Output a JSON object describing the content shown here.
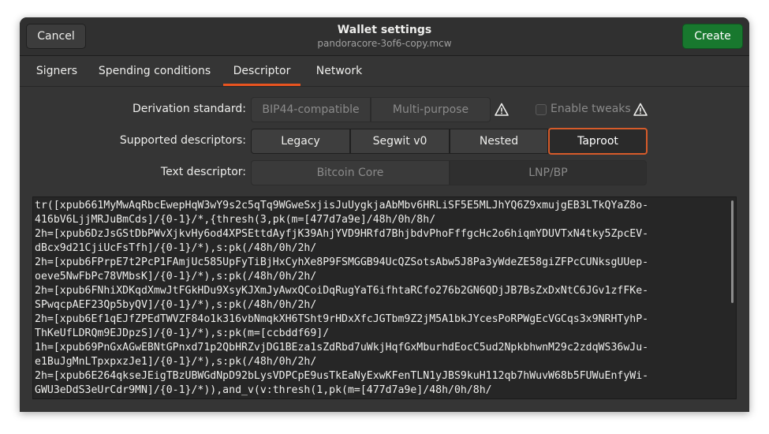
{
  "header": {
    "title": "Wallet settings",
    "subtitle": "pandoracore-3of6-copy.mcw",
    "cancel_label": "Cancel",
    "create_label": "Create"
  },
  "tabs": [
    {
      "label": "Signers",
      "active": false
    },
    {
      "label": "Spending conditions",
      "active": false
    },
    {
      "label": "Descriptor",
      "active": true
    },
    {
      "label": "Network",
      "active": false
    }
  ],
  "derivation": {
    "label": "Derivation standard:",
    "options": [
      "BIP44-compatible",
      "Multi-purpose"
    ],
    "tweaks_label": "Enable tweaks",
    "tweaks_checked": false
  },
  "supported": {
    "label": "Supported descriptors:",
    "options": [
      "Legacy",
      "Segwit v0",
      "Nested",
      "Taproot"
    ],
    "selected": "Taproot"
  },
  "text_descriptor": {
    "label": "Text descriptor:",
    "options": [
      "Bitcoin Core",
      "LNP/BP"
    ],
    "selected": "LNP/BP"
  },
  "descriptor_lines": [
    "tr([xpub661MyMwAqRbcEwepHqW3wY9s2c5qTq9WGweSxjisJuUygkjaAbMbv6HRLiSF5E5MLJhYQ6Z9xmujgEB3LTkQYaZ8o-",
    "416bV6LjjMRJuBmCds]/{0-1}/*,{thresh(3,pk(m=[477d7a9e]/48h/0h/8h/",
    "2h=[xpub6DzJsGStDbPWvXjkvHy6od4XPSEttdAyfjK39AhjYVD9HRfd7BhjbdvPhoFffgcHc2o6hiqmYDUVTxN4tky5ZpcEV-",
    "dBcx9d21CjiUcFsTfh]/{0-1}/*),s:pk(/48h/0h/2h/",
    "2h=[xpub6FPrpE7t2PcP1FAmjUc585UpFyTiBjHxCyhXe8P9FSMGGB94UcQZSotsAbw5J8Pa3yWdeZE58giZFPcCUNksgUUep-",
    "oeve5NwFbPc78VMbsK]/{0-1}/*),s:pk(/48h/0h/2h/",
    "2h=[xpub6FNhiXDKqdXmwJtFGkHDu9XsyKJXmJyAwxQCoiDqRugYaT6ifhtaRCfo276b2GN6QDjJB7BsZxDxNtC6JGv1zfFKe-",
    "SPwqcpAEF23Qp5byQV]/{0-1}/*),s:pk(/48h/0h/2h/",
    "2h=[xpub6Ef1qEJfZPEdTWVZF84o1k316vbNmqkXH6TSht9rHDxXfcJGTbm9Z2jM5A1bkJYcesPoRPWgEcVGCqs3x9NRHTyhP-",
    "ThKeUfLDRQm9EJDpzS]/{0-1}/*),s:pk(m=[ccbddf69]/",
    "1h=[xpub69PnGxAGwEBNtGPnxd71p2QbHRZvjDG1BEza1sZdRbd7uWkjHqfGxMburhdEocC5ud2NpkbhwnM29c2zdqWS36wJu-",
    "e1BuJgMnLTpxpxzJe1]/{0-1}/*),s:pk(/48h/0h/2h/",
    "2h=[xpub6E264qkseJEigTBzUBWGdNpD92bLysVDPCpE9usTkEaNyExwKFenTLN1yJBS9kuH112qb7hWuvW68b5FUWuEnfyWi-",
    "GWU3eDdS3eUrCdr9MN]/{0-1}/*)),and_v(v:thresh(1,pk(m=[477d7a9e]/48h/0h/8h/"
  ],
  "icons": {
    "warning": "warning-triangle-icon"
  }
}
